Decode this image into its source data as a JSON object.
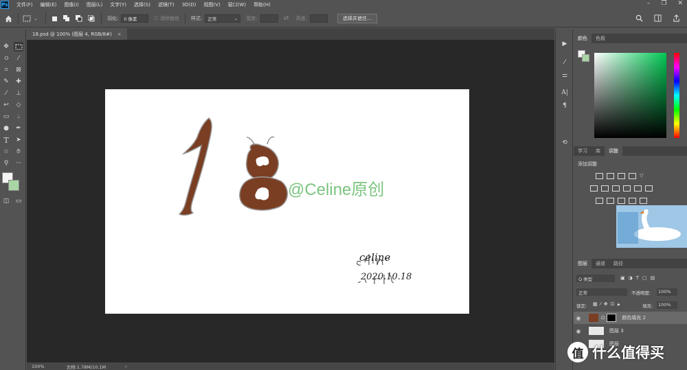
{
  "menu": {
    "logo": "Ps",
    "items": [
      "文件(F)",
      "编辑(E)",
      "图像(I)",
      "图层(L)",
      "文字(Y)",
      "选择(S)",
      "滤镜(T)",
      "3D(D)",
      "视图(V)",
      "窗口(W)",
      "帮助(H)"
    ],
    "window_controls": [
      "–",
      "❐",
      "✕"
    ]
  },
  "options": {
    "feather_label": "羽化:",
    "feather_value": "0 像素",
    "antialias_label": "消除锯齿",
    "style_label": "样式:",
    "style_value": "正常",
    "width_label": "宽度:",
    "height_label": "高度:",
    "select_mask_button": "选择并遮住..."
  },
  "document": {
    "tab_title": "18.psd @ 100% (图层 4, RGB/8#)",
    "tab_close": "×",
    "watermark_text": "@Celine原创",
    "signature_name": "celine",
    "signature_date": "2020.10.18"
  },
  "status": {
    "zoom": "100%",
    "doc_size": "文档:1.78M/10.1M",
    "arrow": "›"
  },
  "panels": {
    "color_tabs": [
      "颜色",
      "色板"
    ],
    "learn_tabs": [
      "学习",
      "库",
      "调整"
    ],
    "adjust_title": "添加调整",
    "layers_tabs": [
      "图层",
      "通道",
      "路径"
    ],
    "kind_label": "Q 类型",
    "blend_mode": "正常",
    "opacity_label": "不透明度:",
    "opacity_value": "100%",
    "lock_label": "锁定:",
    "fill_label": "填充:",
    "fill_value": "100%",
    "layers": [
      {
        "name": "颜色填充 2",
        "selected": true
      },
      {
        "name": "图层 3",
        "selected": false
      },
      {
        "name": "图层",
        "selected": false
      }
    ]
  },
  "colors": {
    "brand": "#31a8ff",
    "digit_brown": "#7a3e22",
    "watermark": "#7bc47f",
    "fg_color": "#f4f4f4",
    "bg_color": "#a8d5a4"
  },
  "overlay_logo": {
    "badge": "值",
    "text": "什么值得买"
  }
}
